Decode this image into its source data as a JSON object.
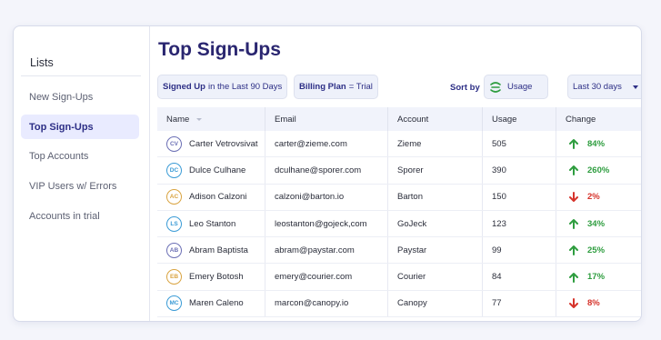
{
  "sidebar": {
    "title": "Lists",
    "items": [
      {
        "label": "New Sign-Ups",
        "active": false
      },
      {
        "label": "Top Sign-Ups",
        "active": true
      },
      {
        "label": "Top Accounts",
        "active": false
      },
      {
        "label": "VIP Users w/ Errors",
        "active": false
      },
      {
        "label": "Accounts in trial",
        "active": false
      }
    ]
  },
  "main": {
    "title": "Top Sign-Ups",
    "filters": [
      {
        "key": "Signed Up",
        "rest": "in the Last 90 Days"
      },
      {
        "key": "Billing Plan",
        "rest": "= Trial"
      }
    ],
    "sort_label": "Sort by",
    "sort_value": "Usage",
    "sort_icon": "sort-lines-icon",
    "date_range": "Last 30 days"
  },
  "table": {
    "headers": [
      "Name",
      "Email",
      "Account",
      "Usage",
      "Change"
    ],
    "rows": [
      {
        "initials": "CV",
        "name": "Carter Vetrovsivat",
        "email": "carter@zieme.com",
        "account": "Zieme",
        "usage": "505",
        "change": "84%",
        "direction": "up",
        "avatar_color": "#6b6fb5"
      },
      {
        "initials": "DC",
        "name": "Dulce Culhane",
        "email": "dculhane@sporer.com",
        "account": "Sporer",
        "usage": "390",
        "change": "260%",
        "direction": "up",
        "avatar_color": "#3a9bd6"
      },
      {
        "initials": "AC",
        "name": "Adison Calzoni",
        "email": "calzoni@barton.io",
        "account": "Barton",
        "usage": "150",
        "change": "2%",
        "direction": "down",
        "avatar_color": "#d9a441"
      },
      {
        "initials": "LS",
        "name": "Leo Stanton",
        "email": "leostanton@gojeck,com",
        "account": "GoJeck",
        "usage": "123",
        "change": "34%",
        "direction": "up",
        "avatar_color": "#3a9bd6"
      },
      {
        "initials": "AB",
        "name": "Abram Baptista",
        "email": "abram@paystar.com",
        "account": "Paystar",
        "usage": "99",
        "change": "25%",
        "direction": "up",
        "avatar_color": "#6b6fb5"
      },
      {
        "initials": "EB",
        "name": "Emery Botosh",
        "email": "emery@courier.com",
        "account": "Courier",
        "usage": "84",
        "change": "17%",
        "direction": "up",
        "avatar_color": "#d9a441"
      },
      {
        "initials": "MC",
        "name": "Maren Caleno",
        "email": "marcon@canopy.io",
        "account": "Canopy",
        "usage": "77",
        "change": "8%",
        "direction": "down",
        "avatar_color": "#3a9bd6"
      }
    ]
  },
  "colors": {
    "up": "#2e9d3f",
    "down": "#d6332b",
    "accent": "#2d2f86",
    "active_bg": "#e9ebff"
  }
}
